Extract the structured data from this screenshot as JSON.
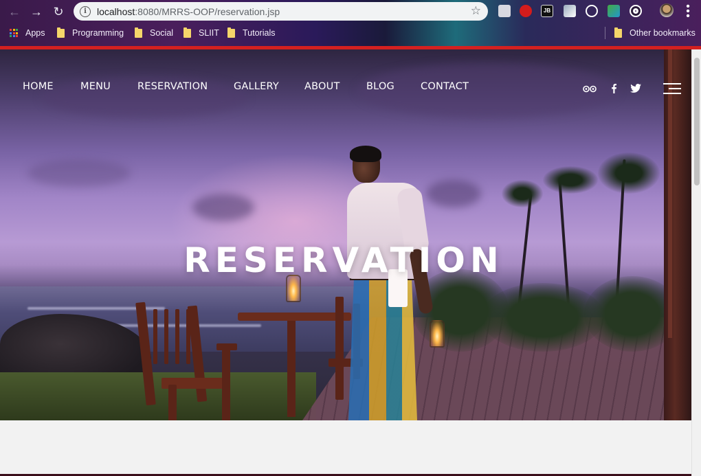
{
  "browser": {
    "url_host": "localhost",
    "url_rest": ":8080/MRRS-OOP/reservation.jsp",
    "icons": [
      "back-icon",
      "forward-icon",
      "reload-icon",
      "info-icon",
      "star-icon",
      "menu-icon"
    ],
    "bookmarks": [
      {
        "label": "Apps",
        "icon": "apps-grid-icon"
      },
      {
        "label": "Programming",
        "icon": "folder-icon"
      },
      {
        "label": "Social",
        "icon": "folder-icon"
      },
      {
        "label": "SLIIT",
        "icon": "folder-icon"
      },
      {
        "label": "Tutorials",
        "icon": "folder-icon"
      }
    ],
    "other_bookmarks": "Other bookmarks",
    "extensions": [
      "cube-extension-icon",
      "adblock-extension-icon",
      "jb-extension-icon",
      "tools-extension-icon",
      "react-extension-icon",
      "wappalyzer-extension-icon",
      "target-extension-icon",
      "profile-avatar"
    ],
    "accent_bar_color": "#d42020"
  },
  "site": {
    "nav": [
      {
        "label": "HOME"
      },
      {
        "label": "MENU"
      },
      {
        "label": "RESERVATION"
      },
      {
        "label": "GALLERY"
      },
      {
        "label": "ABOUT"
      },
      {
        "label": "BLOG"
      },
      {
        "label": "CONTACT"
      }
    ],
    "social": [
      "tripadvisor-icon",
      "facebook-icon",
      "twitter-icon"
    ],
    "hero_title": "RESERVATION"
  }
}
